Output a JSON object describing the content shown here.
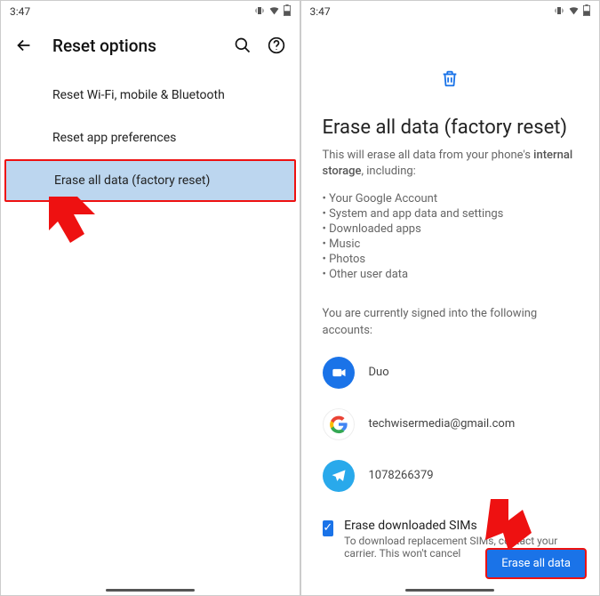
{
  "status": {
    "time": "3:47"
  },
  "screen1": {
    "title": "Reset options",
    "items": [
      {
        "label": "Reset Wi-Fi, mobile & Bluetooth"
      },
      {
        "label": "Reset app preferences"
      },
      {
        "label": "Erase all data (factory reset)"
      }
    ]
  },
  "screen2": {
    "title": "Erase all data (factory reset)",
    "subtitle_pre": "This will erase all data from your phone's ",
    "subtitle_bold": "internal storage",
    "subtitle_post": ", including:",
    "bullets": [
      "• Your Google Account",
      "• System and app data and settings",
      "• Downloaded apps",
      "• Music",
      "• Photos",
      "• Other user data"
    ],
    "signed_in_text": "You are currently signed into the following accounts:",
    "accounts": [
      {
        "name": "Duo",
        "icon": "duo"
      },
      {
        "name": "techwisermedia@gmail.com",
        "icon": "google"
      },
      {
        "name": "1078266379",
        "icon": "telegram"
      }
    ],
    "esim": {
      "title": "Erase downloaded SIMs",
      "subtitle": "To download replacement SIMs, contact your carrier. This won't cancel"
    },
    "button_label": "Erase all data"
  }
}
